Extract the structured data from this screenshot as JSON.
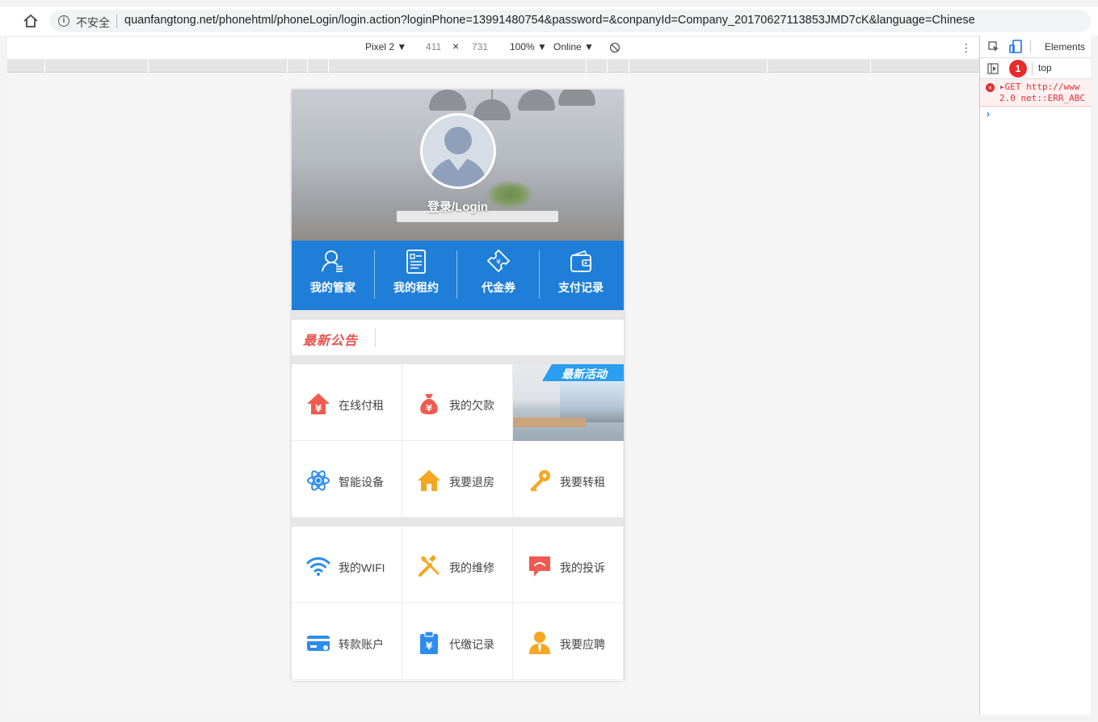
{
  "browser": {
    "insecure_label": "不安全",
    "url": "quanfangtong.net/phonehtml/phoneLogin/login.action?loginPhone=13991480754&password=&conpanyId=Company_20170627113853JMD7cK&language=Chinese"
  },
  "device_toolbar": {
    "device": "Pixel 2 ▼",
    "width": "411",
    "times": "×",
    "height": "731",
    "zoom": "100% ▼",
    "network": "Online ▼"
  },
  "devtools": {
    "elements_tab": "Elements",
    "error_count": "1",
    "context": "top",
    "error_line1": "▸GET http://www",
    "error_line2": "2.0 net::ERR_ABC",
    "prompt": "›"
  },
  "page": {
    "login_label": "登录/Login",
    "quick_actions": [
      {
        "label": "我的管家",
        "icon": "person-icon"
      },
      {
        "label": "我的租约",
        "icon": "document-icon"
      },
      {
        "label": "代金券",
        "icon": "voucher-icon"
      },
      {
        "label": "支付记录",
        "icon": "wallet-icon"
      }
    ],
    "notice_tag": "最新公告",
    "promo_banner": "最新活动",
    "grid1": [
      {
        "label": "在线付租",
        "icon": "house-yen-icon",
        "color": "#f05a4f"
      },
      {
        "label": "我的欠款",
        "icon": "money-bag-icon",
        "color": "#f05a4f"
      },
      {
        "label": "智能设备",
        "icon": "atom-icon",
        "color": "#2d8cf0"
      },
      {
        "label": "我要退房",
        "icon": "house-icon",
        "color": "#f5a623"
      },
      {
        "label": "我要转租",
        "icon": "key-icon",
        "color": "#f5a623"
      }
    ],
    "grid2": [
      {
        "label": "我的WIFI",
        "icon": "wifi-icon",
        "color": "#2d8cf0"
      },
      {
        "label": "我的维修",
        "icon": "tools-icon",
        "color": "#f5a623"
      },
      {
        "label": "我的投诉",
        "icon": "complaint-icon",
        "color": "#f05a4f"
      },
      {
        "label": "转款账户",
        "icon": "card-icon",
        "color": "#2d8cf0"
      },
      {
        "label": "代缴记录",
        "icon": "clipboard-yen-icon",
        "color": "#2d8cf0"
      },
      {
        "label": "我要应聘",
        "icon": "applicant-icon",
        "color": "#f5a623"
      }
    ]
  }
}
